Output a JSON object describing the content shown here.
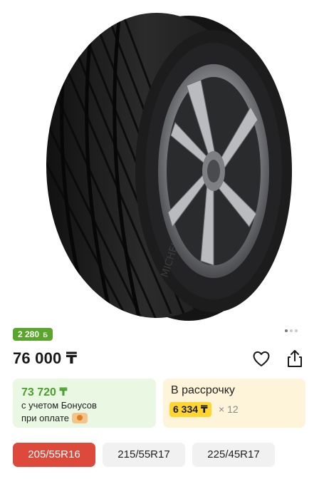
{
  "product": {
    "image_alt": "Michelin tire"
  },
  "bonus_badge": {
    "value": "2 280",
    "coin": "Б"
  },
  "price": "76 000 ₸",
  "bonus_card": {
    "price": "73 720 ₸",
    "line1": "с учетом Бонусов",
    "line2": "при оплате"
  },
  "installment_card": {
    "title": "В рассрочку",
    "amount": "6 334 ₸",
    "multiplier": "× 12"
  },
  "sizes": [
    {
      "label": "205/55R16",
      "selected": true
    },
    {
      "label": "215/55R17",
      "selected": false
    },
    {
      "label": "225/45R17",
      "selected": false
    }
  ],
  "colors": {
    "accent_red": "#dd4a3c",
    "bonus_green": "#5aa52c",
    "installment_yellow": "#ffd52e"
  },
  "icons": [
    "heart-icon",
    "share-icon",
    "kaspi-icon"
  ]
}
